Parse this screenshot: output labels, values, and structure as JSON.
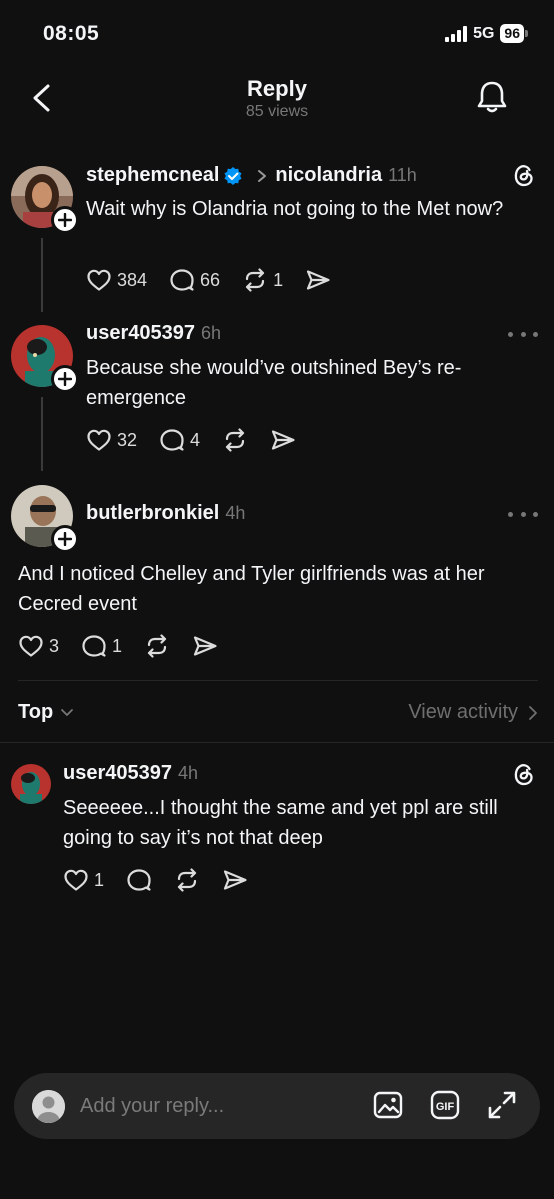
{
  "status": {
    "time": "08:05",
    "network": "5G",
    "battery": "96"
  },
  "nav": {
    "title": "Reply",
    "subtitle": "85 views"
  },
  "posts": [
    {
      "username": "stephemcneal",
      "verified": true,
      "reply_to": "nicolandria",
      "time": "11h",
      "text": "Wait why is Olandria not going to the Met now?",
      "likes": "384",
      "comments": "66",
      "reposts": "1"
    },
    {
      "username": "user405397",
      "time": "6h",
      "text": "Because she would’ve outshined Bey’s re-emergence",
      "likes": "32",
      "comments": "4",
      "reposts": ""
    },
    {
      "username": "butlerbronkiel",
      "time": "4h",
      "text": "And I noticed Chelley and Tyler girlfriends was at her Cecred event",
      "likes": "3",
      "comments": "1",
      "reposts": ""
    }
  ],
  "sort": {
    "label": "Top",
    "view_activity": "View activity"
  },
  "replies": [
    {
      "username": "user405397",
      "time": "4h",
      "text": "Seeeeee...I thought the same and yet ppl are still going to say it’s not that deep",
      "likes": "1",
      "comments": ""
    }
  ],
  "composer": {
    "placeholder": "Add your reply..."
  },
  "icons": [
    "back-chevron-icon",
    "bell-icon",
    "verified-badge-icon",
    "threads-logo-icon",
    "heart-icon",
    "comment-icon",
    "repost-icon",
    "share-icon",
    "more-icon",
    "image-icon",
    "gif-icon",
    "expand-icon"
  ],
  "colors": {
    "background": "#101010",
    "text": "#f3f5f7",
    "muted": "#777777",
    "verified": "#0095f6",
    "composer": "#262626"
  }
}
